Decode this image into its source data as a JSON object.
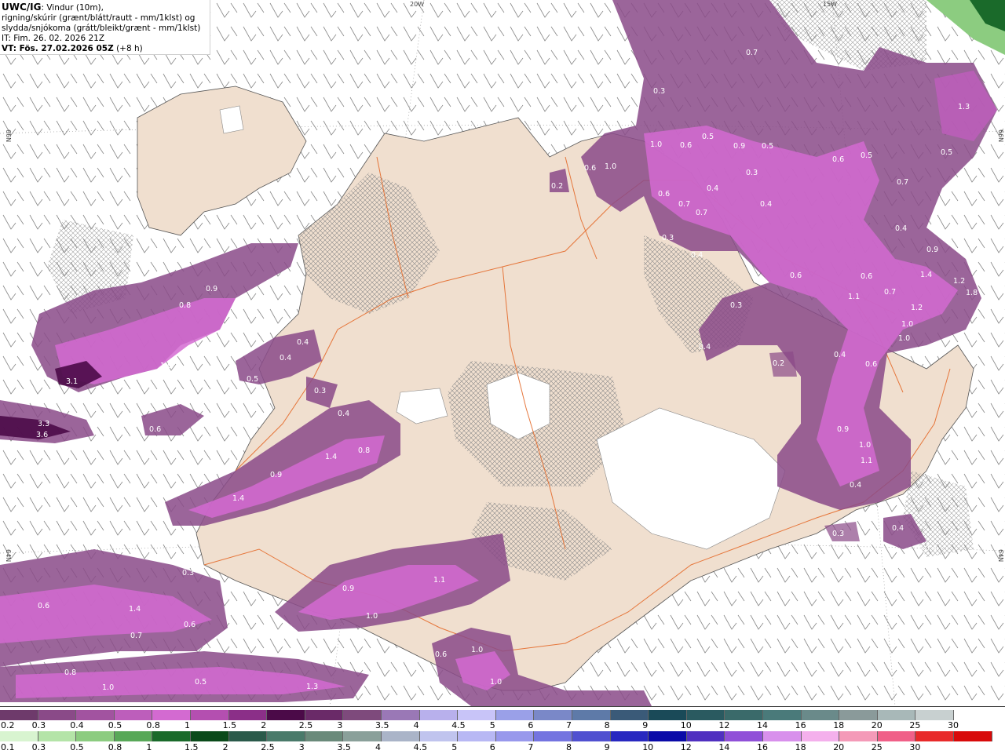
{
  "header": {
    "title": "UWC/IG",
    "title_suffix": ": Vindur (10m),",
    "line2": "rigning/skúrir (grænt/blátt/rautt - mm/1klst) og",
    "line3": "slydda/snjókoma (grátt/bleikt/grænt - mm/1klst)",
    "line4": "IT: Fim. 26. 02. 2026 21Z",
    "line5_bold": "VT: Fös. 27.02.2026 05Z",
    "line5_suffix": " (+8 h)"
  },
  "coords": {
    "lon_20w": "20W",
    "lon_15w": "15W",
    "lat_66n": "66N",
    "lat_64n": "64N"
  },
  "precip_labels": [
    {
      "id": "v1",
      "text": "3.1"
    },
    {
      "id": "v2",
      "text": "3.3"
    },
    {
      "id": "v3",
      "text": "3.6"
    },
    {
      "id": "v4",
      "text": "1.0"
    },
    {
      "id": "v5",
      "text": "1.2"
    },
    {
      "id": "v6",
      "text": "0.8"
    },
    {
      "id": "v7",
      "text": "0.9"
    },
    {
      "id": "v8",
      "text": "0.6"
    },
    {
      "id": "v9",
      "text": "0.3"
    },
    {
      "id": "v10",
      "text": "0.4"
    },
    {
      "id": "v11",
      "text": "0.4"
    },
    {
      "id": "v12",
      "text": "0.5"
    },
    {
      "id": "v13",
      "text": "0.3"
    },
    {
      "id": "v14",
      "text": "0.4"
    },
    {
      "id": "v15",
      "text": "1.4"
    },
    {
      "id": "v16",
      "text": "0.8"
    },
    {
      "id": "v17",
      "text": "0.9"
    },
    {
      "id": "v18",
      "text": "1.4"
    },
    {
      "id": "v19",
      "text": "0.3"
    },
    {
      "id": "v20",
      "text": "0.6"
    },
    {
      "id": "v21",
      "text": "1.4"
    },
    {
      "id": "v22",
      "text": "0.7"
    },
    {
      "id": "v23",
      "text": "0.6"
    },
    {
      "id": "v24",
      "text": "0.8"
    },
    {
      "id": "v25",
      "text": "0.5"
    },
    {
      "id": "v26",
      "text": "1.0"
    },
    {
      "id": "v27",
      "text": "1.3"
    },
    {
      "id": "v28",
      "text": "0.9"
    },
    {
      "id": "v29",
      "text": "1.0"
    },
    {
      "id": "v30",
      "text": "1.1"
    },
    {
      "id": "v31",
      "text": "0.6"
    },
    {
      "id": "v32",
      "text": "1.0"
    },
    {
      "id": "v33",
      "text": "1.0"
    },
    {
      "id": "v34",
      "text": "0.3"
    },
    {
      "id": "v35",
      "text": "1.0"
    },
    {
      "id": "v36",
      "text": "0.6"
    },
    {
      "id": "v37",
      "text": "0.2"
    },
    {
      "id": "v38",
      "text": "0.7"
    },
    {
      "id": "v39",
      "text": "1.0"
    },
    {
      "id": "v40",
      "text": "0.6"
    },
    {
      "id": "v41",
      "text": "0.5"
    },
    {
      "id": "v42",
      "text": "0.9"
    },
    {
      "id": "v43",
      "text": "0.5"
    },
    {
      "id": "v44",
      "text": "0.3"
    },
    {
      "id": "v45",
      "text": "0.4"
    },
    {
      "id": "v46",
      "text": "0.4"
    },
    {
      "id": "v47",
      "text": "0.7"
    },
    {
      "id": "v48",
      "text": "0.6"
    },
    {
      "id": "v49",
      "text": "0.7"
    },
    {
      "id": "v50",
      "text": "1.3"
    },
    {
      "id": "v51",
      "text": "0.5"
    },
    {
      "id": "v52",
      "text": "0.6"
    },
    {
      "id": "v53",
      "text": "0.5"
    },
    {
      "id": "v54",
      "text": "0.7"
    },
    {
      "id": "v55",
      "text": "0.4"
    },
    {
      "id": "v56",
      "text": "0.9"
    },
    {
      "id": "v57",
      "text": "1.4"
    },
    {
      "id": "v58",
      "text": "1.2"
    },
    {
      "id": "v59",
      "text": "1.8"
    },
    {
      "id": "v60",
      "text": "0.6"
    },
    {
      "id": "v61",
      "text": "1.1"
    },
    {
      "id": "v62",
      "text": "0.7"
    },
    {
      "id": "v63",
      "text": "1.2"
    },
    {
      "id": "v64",
      "text": "1.0"
    },
    {
      "id": "v65",
      "text": "1.0"
    },
    {
      "id": "v66",
      "text": "0.4"
    },
    {
      "id": "v67",
      "text": "0.6"
    },
    {
      "id": "v68",
      "text": "0.9"
    },
    {
      "id": "v69",
      "text": "1.0"
    },
    {
      "id": "v70",
      "text": "1.1"
    },
    {
      "id": "v71",
      "text": "0.4"
    },
    {
      "id": "v72",
      "text": "0.3"
    },
    {
      "id": "v73",
      "text": "0.4"
    },
    {
      "id": "v74",
      "text": "0.3"
    },
    {
      "id": "v75",
      "text": "0.2"
    },
    {
      "id": "v76",
      "text": "0.4"
    },
    {
      "id": "v77",
      "text": "0.3"
    },
    {
      "id": "v78",
      "text": "0.4"
    },
    {
      "id": "v79",
      "text": "0.6"
    },
    {
      "id": "v80",
      "text": "0.4"
    }
  ],
  "legend_top": {
    "labels": [
      "0.2",
      "0.3",
      "0.4",
      "0.5",
      "0.8",
      "1",
      "1.5",
      "2",
      "2.5",
      "3",
      "3.5",
      "4",
      "4.5",
      "5",
      "6",
      "7",
      "8",
      "9",
      "10",
      "12",
      "14",
      "16",
      "18",
      "20",
      "25",
      "30"
    ],
    "colors": [
      "#6e3a6b",
      "#8a4a88",
      "#a253a0",
      "#bd5ebb",
      "#d36ad1",
      "#b44fb0",
      "#8b2f88",
      "#4b0a48",
      "#6a2a68",
      "#7e4a7c",
      "#9a78b6",
      "#b8b0ec",
      "#c8c4f8",
      "#9aa0e8",
      "#7a88c8",
      "#5e7aa8",
      "#3a5a78",
      "#1a4a58",
      "#2a5a60",
      "#3a6a6a",
      "#4a7a7a",
      "#6a8a8a",
      "#8a9a9a",
      "#a8b8b8",
      "#c8d0d0"
    ]
  },
  "legend_bottom": {
    "labels": [
      "0.1",
      "0.3",
      "0.5",
      "0.8",
      "1",
      "1.5",
      "2",
      "2.5",
      "3",
      "3.5",
      "4",
      "4.5",
      "5",
      "6",
      "7",
      "8",
      "9",
      "10",
      "12",
      "14",
      "16",
      "18",
      "20",
      "25",
      "30"
    ],
    "colors": [
      "#d8f4d0",
      "#b4e4a8",
      "#8ccc80",
      "#58a858",
      "#1a6a2a",
      "#0a4a1a",
      "#2a5a4a",
      "#4a7a6a",
      "#6a8a7a",
      "#8aa09a",
      "#aab4c8",
      "#c0c4ee",
      "#b8b8f4",
      "#9898ec",
      "#7474e0",
      "#5050d0",
      "#2828c0",
      "#0a0aa8",
      "#5030c0",
      "#9050d8",
      "#d890ec",
      "#f4b0ec",
      "#f49ab8",
      "#f06088",
      "#e82a2a",
      "#d80a0a"
    ]
  }
}
